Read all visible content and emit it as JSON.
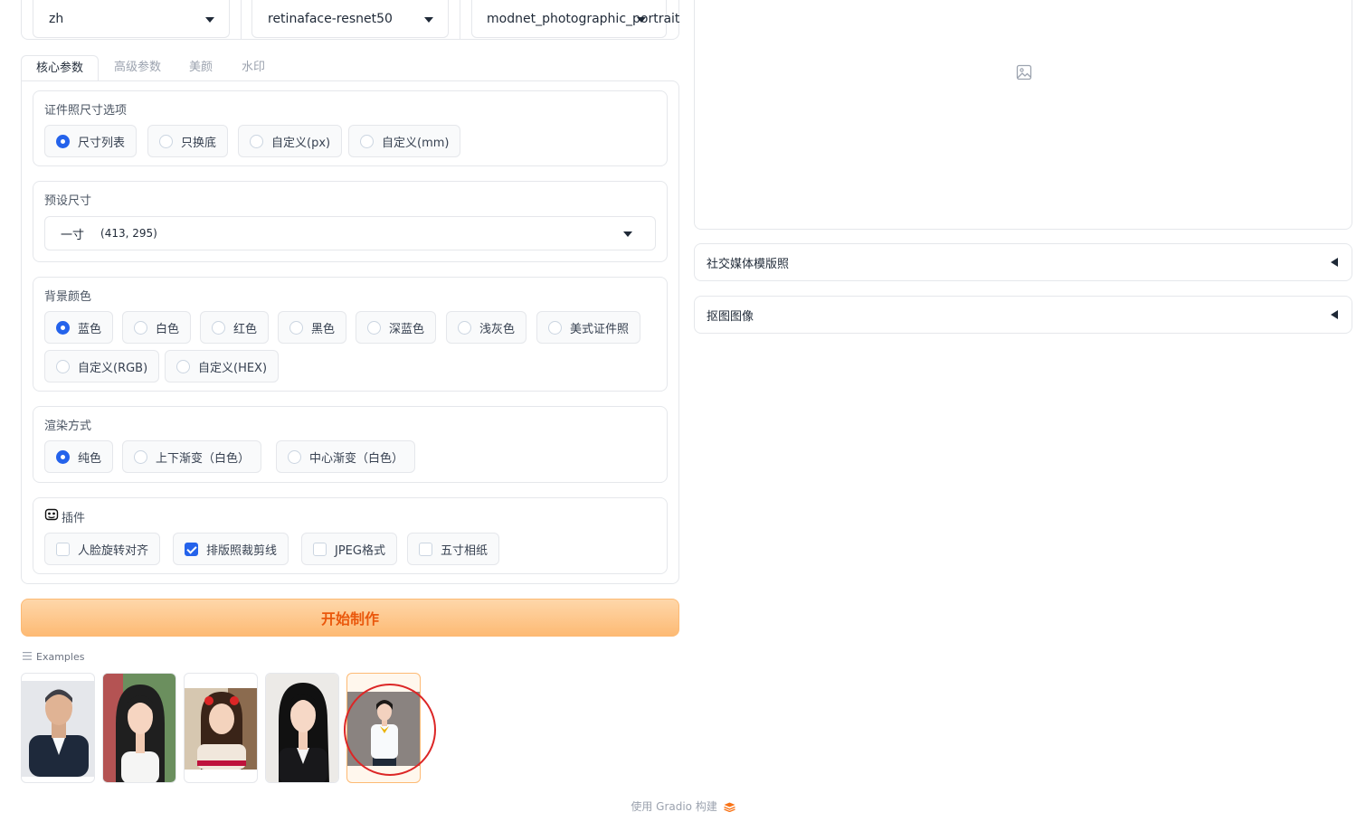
{
  "top_dropdowns": [
    {
      "value": "zh"
    },
    {
      "value": "retinaface-resnet50"
    },
    {
      "value": "modnet_photographic_portrait"
    }
  ],
  "tabs": [
    {
      "label": "核心参数",
      "active": true
    },
    {
      "label": "高级参数",
      "active": false
    },
    {
      "label": "美颜",
      "active": false
    },
    {
      "label": "水印",
      "active": false
    }
  ],
  "size_option": {
    "label": "证件照尺寸选项",
    "options": [
      "尺寸列表",
      "只换底",
      "自定义(px)",
      "自定义(mm)"
    ],
    "selected": "尺寸列表"
  },
  "preset_size": {
    "label": "预设尺寸",
    "value_name": "一寸",
    "value_dims": "(413, 295)"
  },
  "bg_color": {
    "label": "背景颜色",
    "options": [
      "蓝色",
      "白色",
      "红色",
      "黑色",
      "深蓝色",
      "浅灰色",
      "美式证件照",
      "自定义(RGB)",
      "自定义(HEX)"
    ],
    "selected": "蓝色"
  },
  "render_mode": {
    "label": "渲染方式",
    "options": [
      "纯色",
      "上下渐变（白色）",
      "中心渐变（白色）"
    ],
    "selected": "纯色"
  },
  "plugins": {
    "label": "插件",
    "options": [
      {
        "label": "人脸旋转对齐",
        "checked": false
      },
      {
        "label": "排版照裁剪线",
        "checked": true
      },
      {
        "label": "JPEG格式",
        "checked": false
      },
      {
        "label": "五寸相纸",
        "checked": false
      }
    ]
  },
  "start_button": "开始制作",
  "examples": {
    "label": "Examples",
    "selected_index": 4
  },
  "footer": "使用 Gradio 构建",
  "accordions": [
    {
      "label": "社交媒体模版照"
    },
    {
      "label": "抠图图像"
    }
  ],
  "colors": {
    "accent": "#2563eb",
    "button_orange": "#ea580c",
    "highlight_circle": "#dc2626"
  }
}
